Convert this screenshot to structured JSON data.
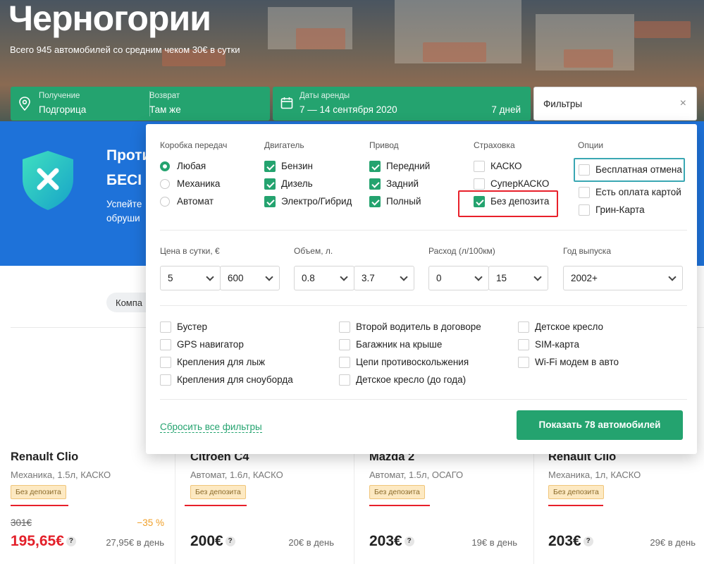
{
  "hero": {
    "title": "Черногории",
    "subtitle": "Всего 945 автомобилей со средним чеком 30€ в сутки"
  },
  "search": {
    "pickup_label": "Получение",
    "pickup_value": "Подгорица",
    "return_label": "Возврат",
    "return_value": "Там же",
    "dates_label": "Даты аренды",
    "dates_value": "7 — 14 сентября 2020",
    "days": "7 дней",
    "filters_label": "Фильтры",
    "close_glyph": "×"
  },
  "banner": {
    "line1": "Проти",
    "line2": "БЕСI",
    "line3a": "Успейте",
    "line3b": "обруши"
  },
  "chip": "Компа",
  "filters": {
    "gearbox": {
      "title": "Коробка передач",
      "options": [
        {
          "label": "Любая",
          "on": true
        },
        {
          "label": "Механика",
          "on": false
        },
        {
          "label": "Автомат",
          "on": false
        }
      ]
    },
    "engine": {
      "title": "Двигатель",
      "options": [
        {
          "label": "Бензин",
          "on": true
        },
        {
          "label": "Дизель",
          "on": true
        },
        {
          "label": "Электро/Гибрид",
          "on": true
        }
      ]
    },
    "drive": {
      "title": "Привод",
      "options": [
        {
          "label": "Передний",
          "on": true
        },
        {
          "label": "Задний",
          "on": true
        },
        {
          "label": "Полный",
          "on": true
        }
      ]
    },
    "insurance": {
      "title": "Страховка",
      "options": [
        {
          "label": "КАСКО",
          "on": false
        },
        {
          "label": "СуперКАСКО",
          "on": false
        },
        {
          "label": "Без депозита",
          "on": true
        }
      ]
    },
    "options": {
      "title": "Опции",
      "options": [
        {
          "label": "Бесплатная отмена",
          "on": false
        },
        {
          "label": "Есть оплата картой",
          "on": false
        },
        {
          "label": "Грин-Карта",
          "on": false
        }
      ]
    },
    "selects": {
      "price": {
        "title": "Цена в сутки, €",
        "from": "5",
        "to": "600"
      },
      "volume": {
        "title": "Объем, л.",
        "from": "0.8",
        "to": "3.7"
      },
      "consumption": {
        "title": "Расход (л/100км)",
        "from": "0",
        "to": "15"
      },
      "year": {
        "title": "Год выпуска",
        "value": "2002+"
      }
    },
    "extras": [
      [
        "Бустер",
        "GPS навигатор",
        "Крепления для лыж",
        "Крепления для сноуборда"
      ],
      [
        "Второй водитель в договоре",
        "Багажник на крыше",
        "Цепи противоскольжения",
        "Детское кресло (до года)"
      ],
      [
        "Детское кресло",
        "SIM-карта",
        "Wi-Fi модем в авто"
      ]
    ],
    "reset_label": "Сбросить все фильтры",
    "show_label": "Показать 78 автомобилей"
  },
  "cards": [
    {
      "name": "Renault Clio",
      "spec": "Механика, 1.5л, КАСКО",
      "badge": "Без депозита",
      "old_price": "301€",
      "discount": "−35 %",
      "price": "195,65€",
      "per_day": "27,95€ в день"
    },
    {
      "name": "Citroen C4",
      "spec": "Автомат, 1.6л, КАСКО",
      "badge": "Без депозита",
      "price": "200€",
      "per_day": "20€ в день"
    },
    {
      "name": "Mazda 2",
      "spec": "Автомат, 1.5л, ОСАГО",
      "badge": "Без депозита",
      "price": "203€",
      "per_day": "19€ в день"
    },
    {
      "name": "Renault Clio",
      "spec": "Механика, 1л, КАСКО",
      "badge": "Без депозита",
      "price": "203€",
      "per_day": "29€ в день"
    }
  ],
  "help_glyph": "?",
  "colors": {
    "accent": "#24a36f",
    "banner": "#1e72d9",
    "highlight": "#e8202a",
    "discount": "#f0a02a",
    "badge_bg": "#fde9c2"
  },
  "icons": [
    "location-pin-icon",
    "calendar-icon",
    "close-icon",
    "shield-icon",
    "chevron-down-icon",
    "checkbox-icon",
    "radio-icon",
    "help-icon"
  ]
}
